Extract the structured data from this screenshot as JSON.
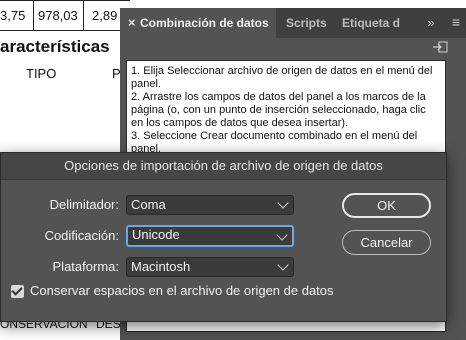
{
  "document": {
    "row": [
      "3,75",
      "978,03",
      "2,89"
    ],
    "section_title": "aracterísticas",
    "col_tipo": "TIPO",
    "col_p": "P",
    "bottom_left": "ONSERVACIÓN",
    "bottom_right": "DESC"
  },
  "panel": {
    "tabs": [
      "Combinación de datos",
      "Scripts",
      "Etiqueta d"
    ],
    "close_glyph": "×",
    "more_glyph": "»",
    "menu_glyph": "≡",
    "instructions": [
      "1. Elija Seleccionar archivo de origen de datos en el menú del panel.",
      "2. Arrastre los campos de datos del panel a los marcos de la página (o, con un punto de inserción seleccionado, haga clic en los campos de datos que desea insertar).",
      "3. Seleccione Crear documento combinado en el menú del panel."
    ]
  },
  "dialog": {
    "title": "Opciones de importación de archivo de origen de datos",
    "delimiter_label": "Delimitador:",
    "delimiter_value": "Coma",
    "encoding_label": "Codificación:",
    "encoding_value": "Unicode",
    "platform_label": "Plataforma:",
    "platform_value": "Macintosh",
    "ok_label": "OK",
    "cancel_label": "Cancelar",
    "preserve_spaces_label": "Conservar espacios en el archivo de origen de datos",
    "preserve_spaces_checked": true
  }
}
